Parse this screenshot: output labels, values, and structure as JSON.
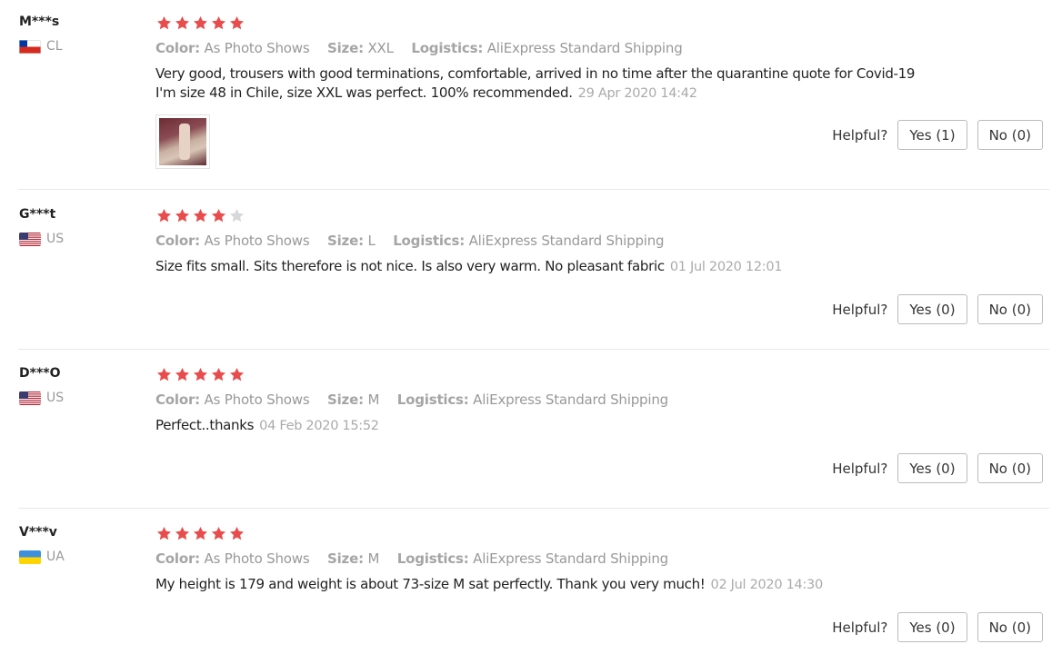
{
  "labels": {
    "color": "Color:",
    "size": "Size:",
    "logistics": "Logistics:",
    "helpful": "Helpful?"
  },
  "colors": {
    "star_on": "#e84c4c",
    "star_off": "#d8d8d8",
    "flag_cl_red": "#d52b1e",
    "flag_us_blue": "#3c3b6e",
    "flag_ua_blue": "#3e8fdc",
    "flag_ua_yellow": "#ffd500"
  },
  "reviews": [
    {
      "user": "M***s",
      "country": "CL",
      "flag_icon": "chile-flag-icon",
      "rating": 5,
      "color": "As Photo Shows",
      "size": "XXL",
      "logistics": "AliExpress Standard Shipping",
      "text_line1": "Very good, trousers with good terminations, comfortable, arrived in no time after the quarantine quote for Covid-19",
      "text_line2": "I'm size 48 in Chile, size XXL was perfect. 100% recommended.",
      "date": "29 Apr 2020 14:42",
      "yes": "Yes (1)",
      "no": "No (0)"
    },
    {
      "user": "G***t",
      "country": "US",
      "flag_icon": "usa-flag-icon",
      "rating": 4,
      "color": "As Photo Shows",
      "size": "L",
      "logistics": "AliExpress Standard Shipping",
      "text_line1": "Size fits small. Sits therefore is not nice. Is also very warm. No pleasant fabric",
      "date": "01 Jul 2020 12:01",
      "yes": "Yes (0)",
      "no": "No (0)"
    },
    {
      "user": "D***O",
      "country": "US",
      "flag_icon": "usa-flag-icon",
      "rating": 5,
      "color": "As Photo Shows",
      "size": "M",
      "logistics": "AliExpress Standard Shipping",
      "text_line1": "Perfect..thanks",
      "date": "04 Feb 2020 15:52",
      "yes": "Yes (0)",
      "no": "No (0)"
    },
    {
      "user": "V***v",
      "country": "UA",
      "flag_icon": "ukraine-flag-icon",
      "rating": 5,
      "color": "As Photo Shows",
      "size": "M",
      "logistics": "AliExpress Standard Shipping",
      "text_line1": "My height is 179 and weight is about 73-size M sat perfectly. Thank you very much!",
      "date": "02 Jul 2020 14:30",
      "yes": "Yes (0)",
      "no": "No (0)"
    }
  ]
}
